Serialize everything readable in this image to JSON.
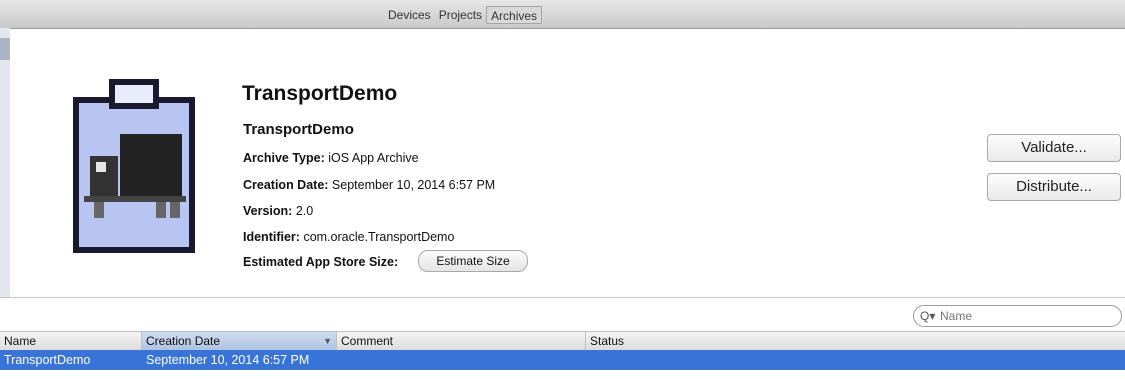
{
  "toolbar": {
    "tabs": [
      {
        "label": "Devices"
      },
      {
        "label": "Projects"
      },
      {
        "label": "Archives"
      }
    ]
  },
  "archive": {
    "title": "TransportDemo",
    "name": "TransportDemo",
    "type_label": "Archive Type:",
    "type_value": "iOS App Archive",
    "date_label": "Creation Date:",
    "date_value": "September 10, 2014 6:57 PM",
    "version_label": "Version:",
    "version_value": "2.0",
    "identifier_label": "Identifier:",
    "identifier_value": "com.oracle.TransportDemo",
    "size_label": "Estimated App Store Size:",
    "estimate_button": "Estimate Size"
  },
  "actions": {
    "validate": "Validate...",
    "distribute": "Distribute..."
  },
  "search": {
    "icon": "magnifier-icon",
    "placeholder": "Name"
  },
  "table": {
    "columns": [
      "Name",
      "Creation Date",
      "Comment",
      "Status"
    ],
    "sorted_column": "Creation Date",
    "rows": [
      {
        "name": "TransportDemo",
        "creation_date": "September 10, 2014 6:57 PM",
        "comment": "",
        "status": ""
      }
    ]
  },
  "colors": {
    "selection": "#3874d8",
    "icon_fill": "#b8c4f2",
    "icon_outline": "#1a1a2e"
  }
}
